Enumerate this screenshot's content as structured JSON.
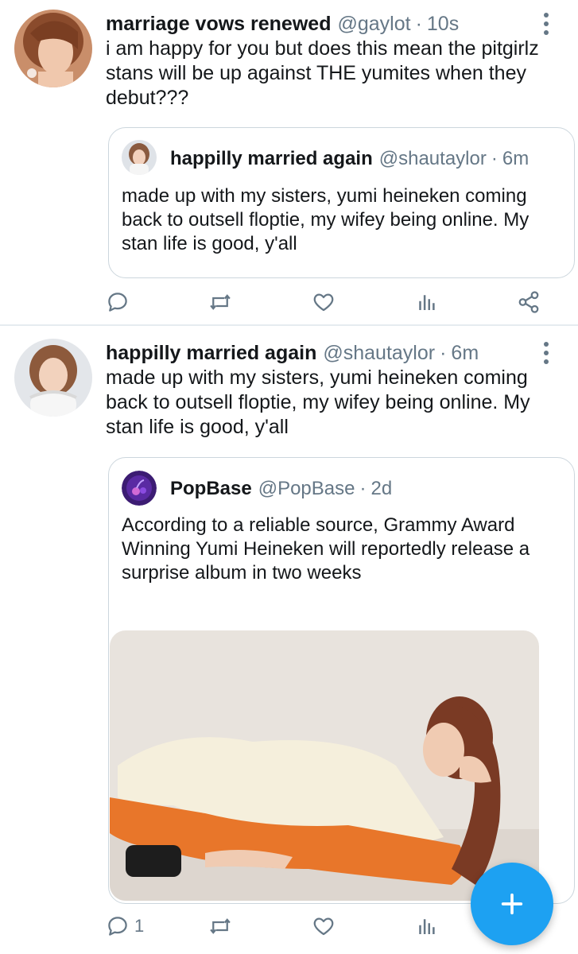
{
  "tweets": [
    {
      "name": "marriage vows renewed",
      "handle": "@gaylot",
      "separator": "·",
      "time": "10s",
      "text": "i am happy for you but does this mean the pitgirlz stans will be up against THE yumites when they debut???",
      "quote": {
        "name": "happilly married again",
        "handle": "@shautaylor",
        "separator": "·",
        "time": "6m",
        "text": "made up with my sisters, yumi heineken coming back to outsell floptie, my wifey being online. My stan life is good, y'all"
      },
      "actions": {
        "reply_count": "",
        "retweet_count": "",
        "like_count": ""
      }
    },
    {
      "name": "happilly married again",
      "handle": "@shautaylor",
      "separator": "·",
      "time": "6m",
      "text": "made up with my sisters, yumi heineken coming back to outsell floptie, my wifey being online. My stan life is good, y'all",
      "quote": {
        "name": "PopBase",
        "handle": "@PopBase",
        "separator": "·",
        "time": "2d",
        "text": "According to a reliable source, Grammy Award Winning Yumi Heineken will reportedly release a surprise album in two weeks"
      },
      "actions": {
        "reply_count": "1",
        "retweet_count": "",
        "like_count": ""
      }
    }
  ],
  "icons": {
    "reply": "reply-icon",
    "retweet": "retweet-icon",
    "like": "heart-icon",
    "stats": "analytics-icon",
    "share": "share-icon",
    "more": "more-vertical-icon",
    "compose": "plus-icon"
  },
  "colors": {
    "accent": "#1da1f2",
    "muted": "#657786",
    "text": "#14171a",
    "border": "#ccd6dd",
    "divider": "#e6ecf0"
  }
}
